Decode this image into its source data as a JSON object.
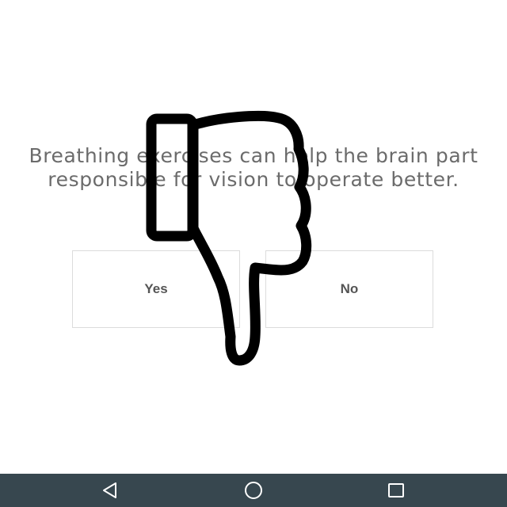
{
  "question": {
    "text": "Breathing exercises can help the brain part responsible for vision to operate better."
  },
  "answers": {
    "yes_label": "Yes",
    "no_label": "No"
  },
  "feedback": {
    "icon": "thumbs-down-icon"
  },
  "navigation": {
    "background_color": "#37474f",
    "back_icon": "back-triangle-icon",
    "home_icon": "home-circle-icon",
    "recents_icon": "recents-square-icon"
  }
}
